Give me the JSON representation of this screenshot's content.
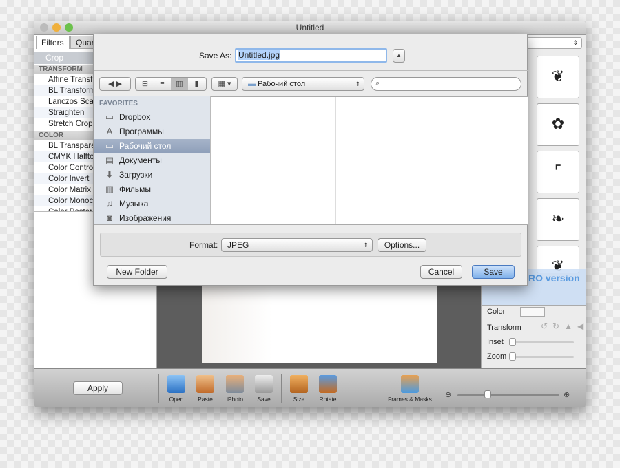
{
  "window": {
    "title": "Untitled"
  },
  "left_panel": {
    "tabs": [
      "Filters",
      "Quar"
    ],
    "search_text": "Crop",
    "sections": [
      {
        "title": "TRANSFORM",
        "items": [
          "Affine Transf",
          "BL Transform",
          "Lanczos Scal",
          "Straighten",
          "Stretch Crop"
        ]
      },
      {
        "title": "COLOR",
        "items": [
          "BL Transpare",
          "CMYK Halfto",
          "Color Contro",
          "Color Invert",
          "Color Matrix",
          "Color Monoc",
          "Color Poster"
        ]
      }
    ]
  },
  "right_panel": {
    "pro_text": "RO version",
    "color_label": "Color",
    "transform_label": "Transform",
    "inset_label": "Inset",
    "zoom_label": "Zoom",
    "inset_value": 0,
    "zoom_value": 0
  },
  "toolbar": {
    "apply": "Apply",
    "tools": [
      "Open",
      "Paste",
      "iPhoto",
      "Save",
      "Size",
      "Rotate"
    ],
    "frames": "Frames & Masks",
    "zoom_value": 0.3
  },
  "dialog": {
    "save_as_label": "Save As:",
    "filename": "Untitled.jpg",
    "location": "Рабочий стол",
    "search_placeholder": "",
    "favorites_title": "FAVORITES",
    "favorites": [
      {
        "label": "Dropbox",
        "icon": "folder-icon"
      },
      {
        "label": "Программы",
        "icon": "applications-icon"
      },
      {
        "label": "Рабочий стол",
        "icon": "desktop-icon",
        "selected": true
      },
      {
        "label": "Документы",
        "icon": "documents-icon"
      },
      {
        "label": "Загрузки",
        "icon": "downloads-icon"
      },
      {
        "label": "Фильмы",
        "icon": "movies-icon"
      },
      {
        "label": "Музыка",
        "icon": "music-icon"
      },
      {
        "label": "Изображения",
        "icon": "pictures-icon"
      }
    ],
    "format_label": "Format:",
    "format": "JPEG",
    "options": "Options...",
    "new_folder": "New Folder",
    "cancel": "Cancel",
    "save": "Save"
  },
  "colors": {
    "accent": "#8fb8ea",
    "selection": "#95a6bf"
  }
}
